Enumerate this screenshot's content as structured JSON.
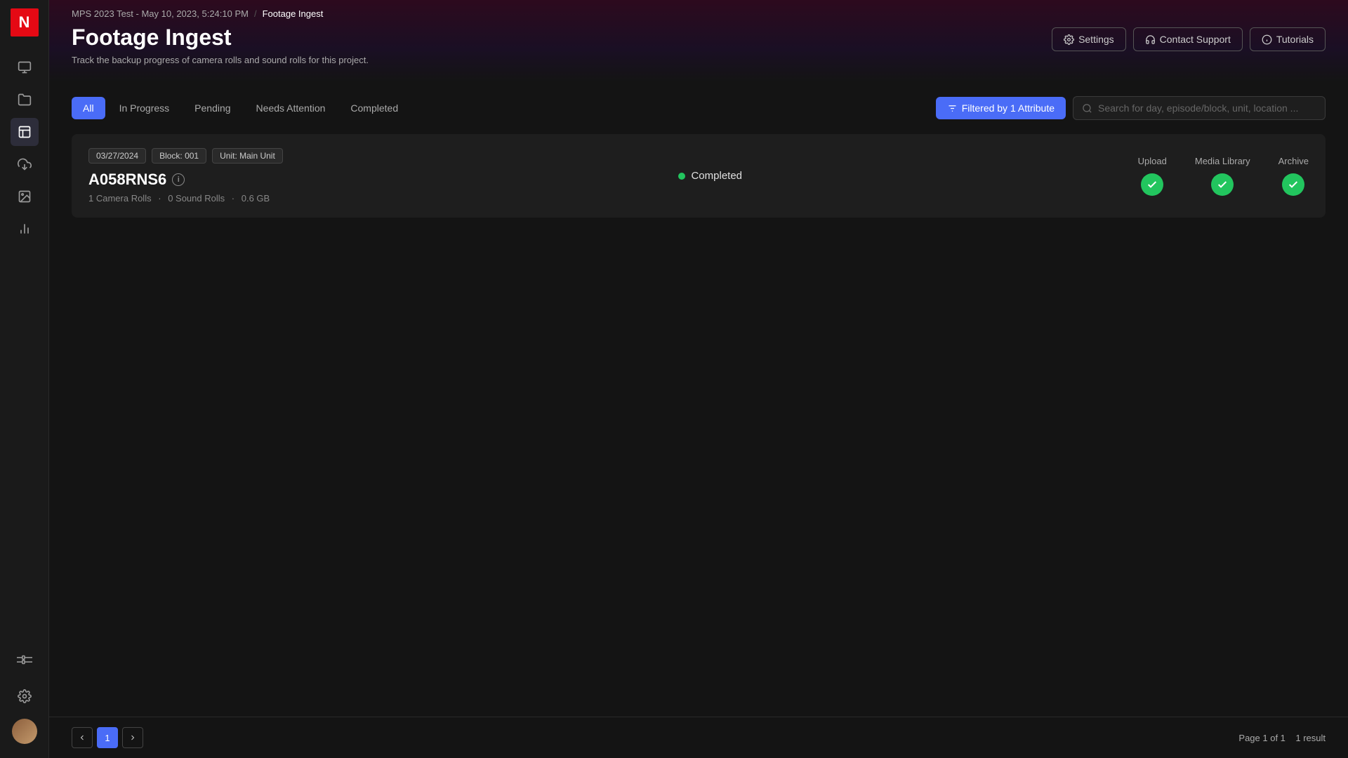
{
  "app": {
    "logo": "N"
  },
  "breadcrumb": {
    "project": "MPS 2023 Test - May 10, 2023, 5:24:10 PM",
    "separator": "/",
    "current": "Footage Ingest"
  },
  "page": {
    "title": "Footage Ingest",
    "subtitle": "Track the backup progress of camera rolls and sound rolls for this project."
  },
  "header_actions": {
    "settings_label": "Settings",
    "contact_label": "Contact Support",
    "tutorials_label": "Tutorials"
  },
  "tabs": [
    {
      "label": "All",
      "active": true
    },
    {
      "label": "In Progress",
      "active": false
    },
    {
      "label": "Pending",
      "active": false
    },
    {
      "label": "Needs Attention",
      "active": false
    },
    {
      "label": "Completed",
      "active": false
    }
  ],
  "filter_button": {
    "label": "Filtered by 1 Attribute"
  },
  "search": {
    "placeholder": "Search for day, episode/block, unit, location ..."
  },
  "cards": [
    {
      "tags": [
        "03/27/2024",
        "Block: 001",
        "Unit: Main Unit"
      ],
      "title": "A058RNS6",
      "camera_rolls": "1 Camera Rolls",
      "sound_rolls": "0 Sound Rolls",
      "size": "0.6 GB",
      "status": "Completed",
      "upload_ok": true,
      "media_library_ok": true,
      "archive_ok": true
    }
  ],
  "column_labels": {
    "upload": "Upload",
    "media_library": "Media Library",
    "archive": "Archive"
  },
  "pagination": {
    "current_page": 1,
    "page_label": "Page 1 of 1",
    "result_count": "1 result"
  },
  "sidebar_icons": [
    "tv",
    "folder",
    "list",
    "photo",
    "chart",
    "settings"
  ],
  "colors": {
    "accent": "#4a6cf7",
    "success": "#22c55e",
    "brand_red": "#e50914"
  }
}
